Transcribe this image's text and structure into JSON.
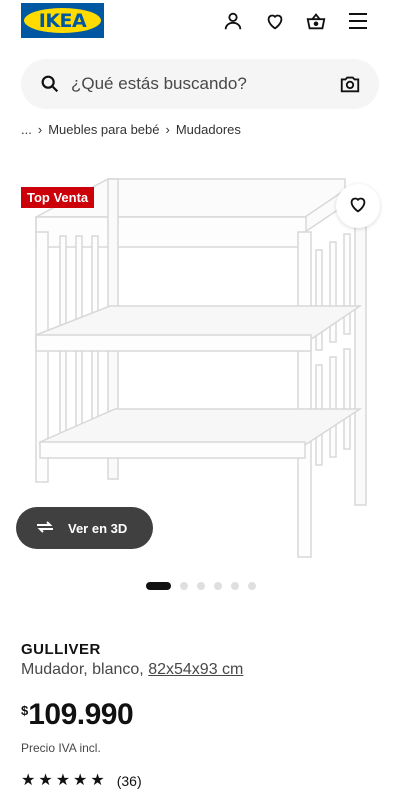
{
  "header": {
    "logo": "IKEA",
    "icons": [
      "user-icon",
      "heart-icon",
      "basket-icon",
      "menu-icon"
    ]
  },
  "search": {
    "placeholder": "¿Qué estás buscando?"
  },
  "breadcrumb": {
    "ellipsis": "...",
    "items": [
      "Muebles para bebé",
      "Mudadores"
    ]
  },
  "gallery": {
    "badge": "Top Venta",
    "view3d_label": "Ver en 3D",
    "image_count": 6,
    "active_index": 0
  },
  "product": {
    "name": "GULLIVER",
    "description": "Mudador, blanco, ",
    "dimensions": "82x54x93 cm",
    "currency": "$",
    "price": "109.990",
    "vat_note": "Precio IVA incl.",
    "rating": 5,
    "review_count": "(36)"
  },
  "colors": {
    "ikea_blue": "#0058a3",
    "ikea_yellow": "#ffdb00",
    "badge_red": "#cc0008",
    "button_dark": "#404040"
  }
}
